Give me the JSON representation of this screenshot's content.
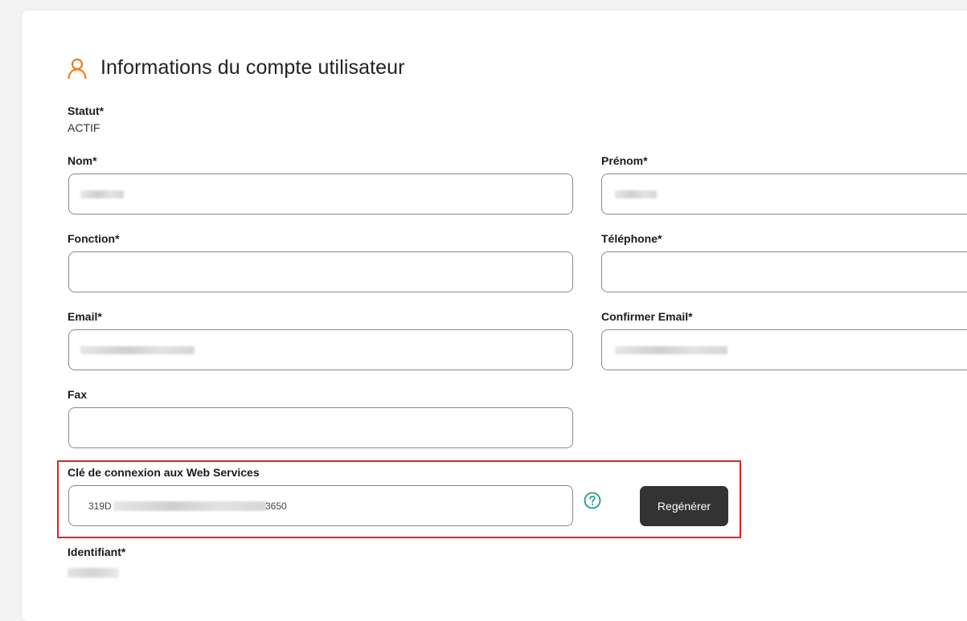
{
  "section": {
    "title": "Informations du compte utilisateur",
    "icon": "user-icon",
    "accent_color": "#f07c1b"
  },
  "statut": {
    "label": "Statut*",
    "value": "ACTIF"
  },
  "fields": {
    "nom": {
      "label": "Nom*",
      "value": ""
    },
    "prenom": {
      "label": "Prénom*",
      "value": ""
    },
    "fonction": {
      "label": "Fonction*",
      "value": ""
    },
    "telephone": {
      "label": "Téléphone*",
      "value": ""
    },
    "email": {
      "label": "Email*",
      "value": ""
    },
    "confirmer_email": {
      "label": "Confirmer Email*",
      "value": ""
    },
    "fax": {
      "label": "Fax",
      "value": ""
    }
  },
  "web_services": {
    "label": "Clé de connexion aux Web Services",
    "key_prefix": "319D",
    "key_suffix": "3650",
    "help_icon": "question-circle-icon",
    "help_color": "#1a9e8f",
    "regenerate_label": "Regénérer"
  },
  "identifiant": {
    "label": "Identifiant*",
    "value": ""
  }
}
